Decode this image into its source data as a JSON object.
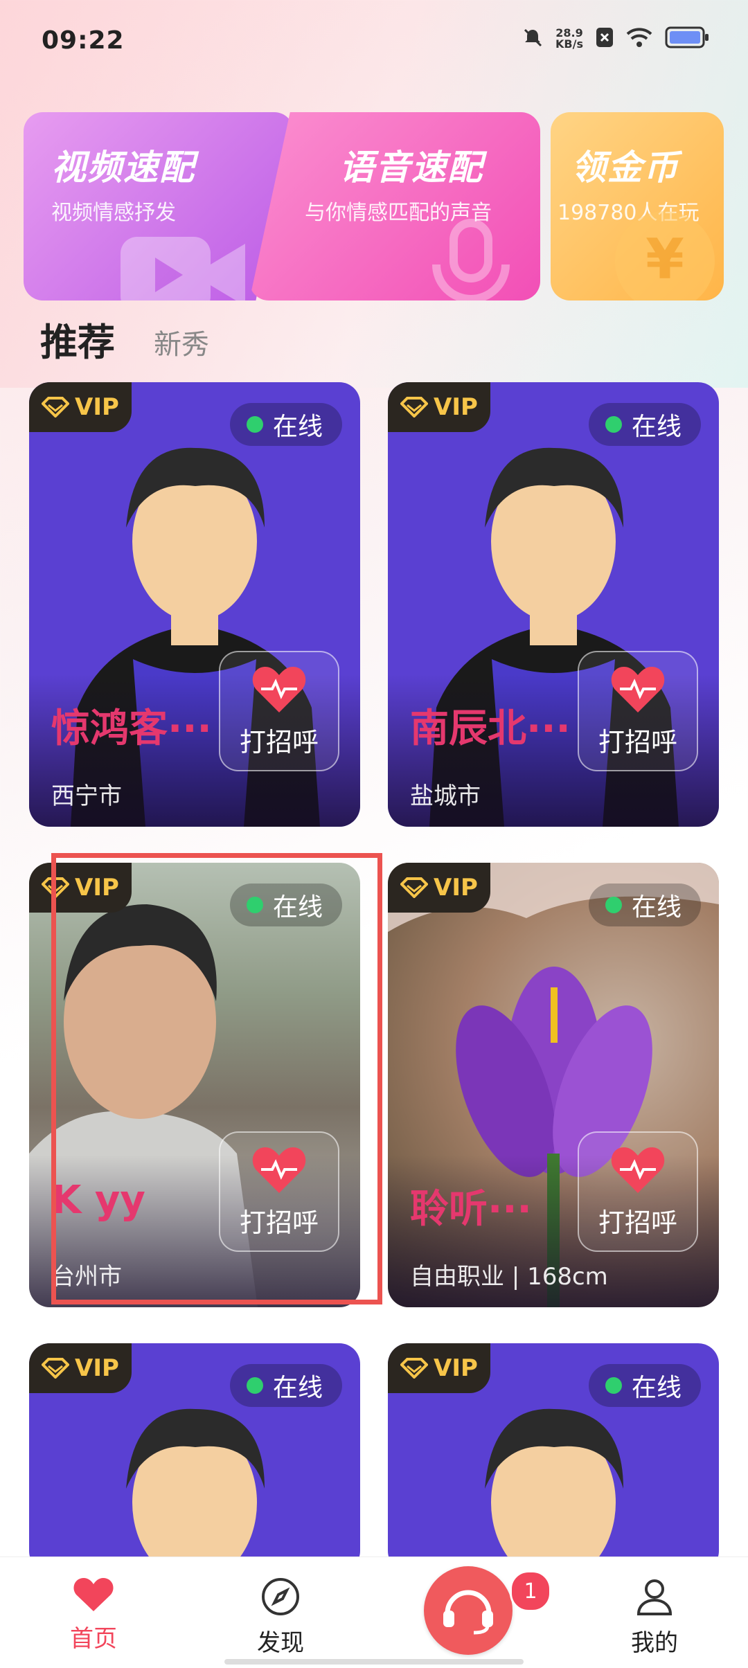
{
  "status_bar": {
    "time": "09:22",
    "net_speed_value": "28.9",
    "net_speed_unit": "KB/s",
    "icons": [
      "mute-icon",
      "close-box-icon",
      "wifi-icon",
      "battery-icon"
    ]
  },
  "features": [
    {
      "title": "视频速配",
      "subtitle": "视频情感抒发",
      "icon": "video-icon"
    },
    {
      "title": "语音速配",
      "subtitle": "与你情感匹配的声音",
      "icon": "microphone-icon"
    },
    {
      "title": "领金币",
      "subtitle": "198780人在玩",
      "icon": "yen-coin-icon"
    }
  ],
  "tabs": [
    {
      "label": "推荐",
      "active": true
    },
    {
      "label": "新秀",
      "active": false
    }
  ],
  "cards": [
    {
      "vip": "VIP",
      "status": "在线",
      "name": "惊鸿客···",
      "sub": "西宁市",
      "action": "打招呼"
    },
    {
      "vip": "VIP",
      "status": "在线",
      "name": "南辰北···",
      "sub": "盐城市",
      "action": "打招呼"
    },
    {
      "vip": "VIP",
      "status": "在线",
      "name": "K yy",
      "sub": "台州市",
      "action": "打招呼"
    },
    {
      "vip": "VIP",
      "status": "在线",
      "name": "聆听···",
      "sub": "自由职业 | 168cm",
      "action": "打招呼"
    },
    {
      "vip": "VIP",
      "status": "在线"
    },
    {
      "vip": "VIP",
      "status": "在线"
    }
  ],
  "bottom_nav": [
    {
      "label": "首页",
      "icon": "heart-icon",
      "active": true
    },
    {
      "label": "发现",
      "icon": "compass-icon",
      "active": false
    },
    {
      "label": "",
      "icon": "headset-icon",
      "badge": "1"
    },
    {
      "label": "我的",
      "icon": "person-icon",
      "active": false
    }
  ],
  "colors": {
    "accent": "#f2455b",
    "avatar_bg": "#5a40d2",
    "online": "#2fcf6e",
    "vip_gold": "#f7c549",
    "highlight": "#ec5350"
  }
}
